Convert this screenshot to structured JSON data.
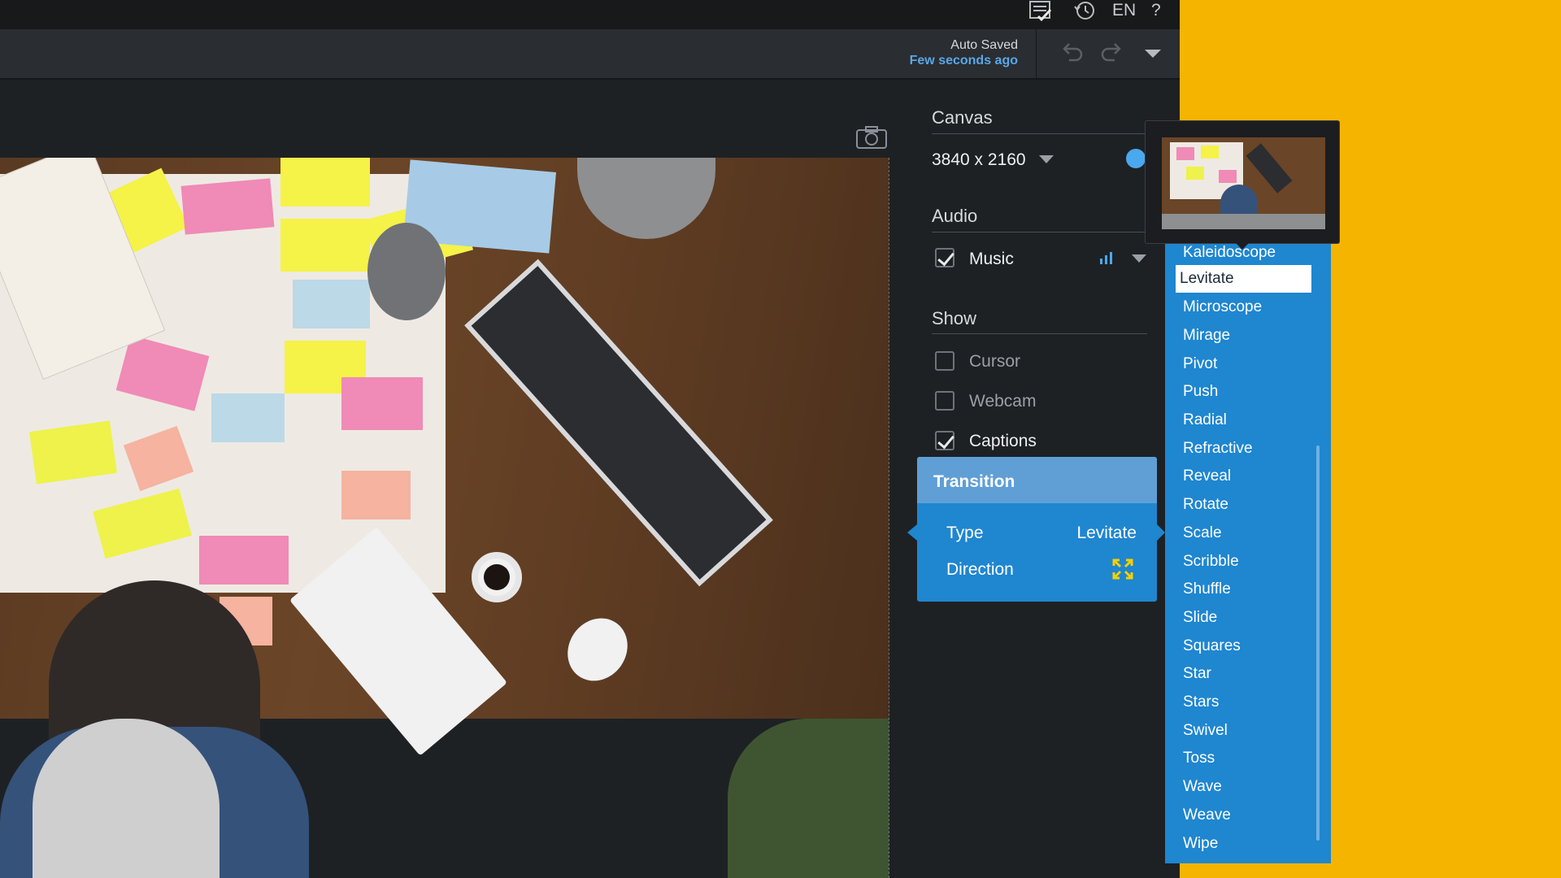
{
  "topbar": {
    "language": "EN",
    "help": "?"
  },
  "toolbar": {
    "autosave_title": "Auto Saved",
    "autosave_time": "Few seconds ago"
  },
  "panel": {
    "canvas_title": "Canvas",
    "canvas_size": "3840 x 2160",
    "audio_title": "Audio",
    "music_label": "Music",
    "music_checked": true,
    "show_title": "Show",
    "cursor_label": "Cursor",
    "cursor_checked": false,
    "webcam_label": "Webcam",
    "webcam_checked": false,
    "captions_label": "Captions",
    "captions_checked": true
  },
  "transition": {
    "title": "Transition",
    "type_label": "Type",
    "type_value": "Levitate",
    "direction_label": "Direction"
  },
  "transition_list": {
    "items": [
      "Kaleidoscope",
      "Levitate",
      "Microscope",
      "Mirage",
      "Pivot",
      "Push",
      "Radial",
      "Refractive",
      "Reveal",
      "Rotate",
      "Scale",
      "Scribble",
      "Shuffle",
      "Slide",
      "Squares",
      "Star",
      "Stars",
      "Swivel",
      "Toss",
      "Wave",
      "Weave",
      "Wipe"
    ],
    "selected": "Levitate"
  },
  "colors": {
    "accent": "#1f86d0",
    "header": "#5f9fd6",
    "background": "#f5b400",
    "link": "#5aa7e6"
  }
}
